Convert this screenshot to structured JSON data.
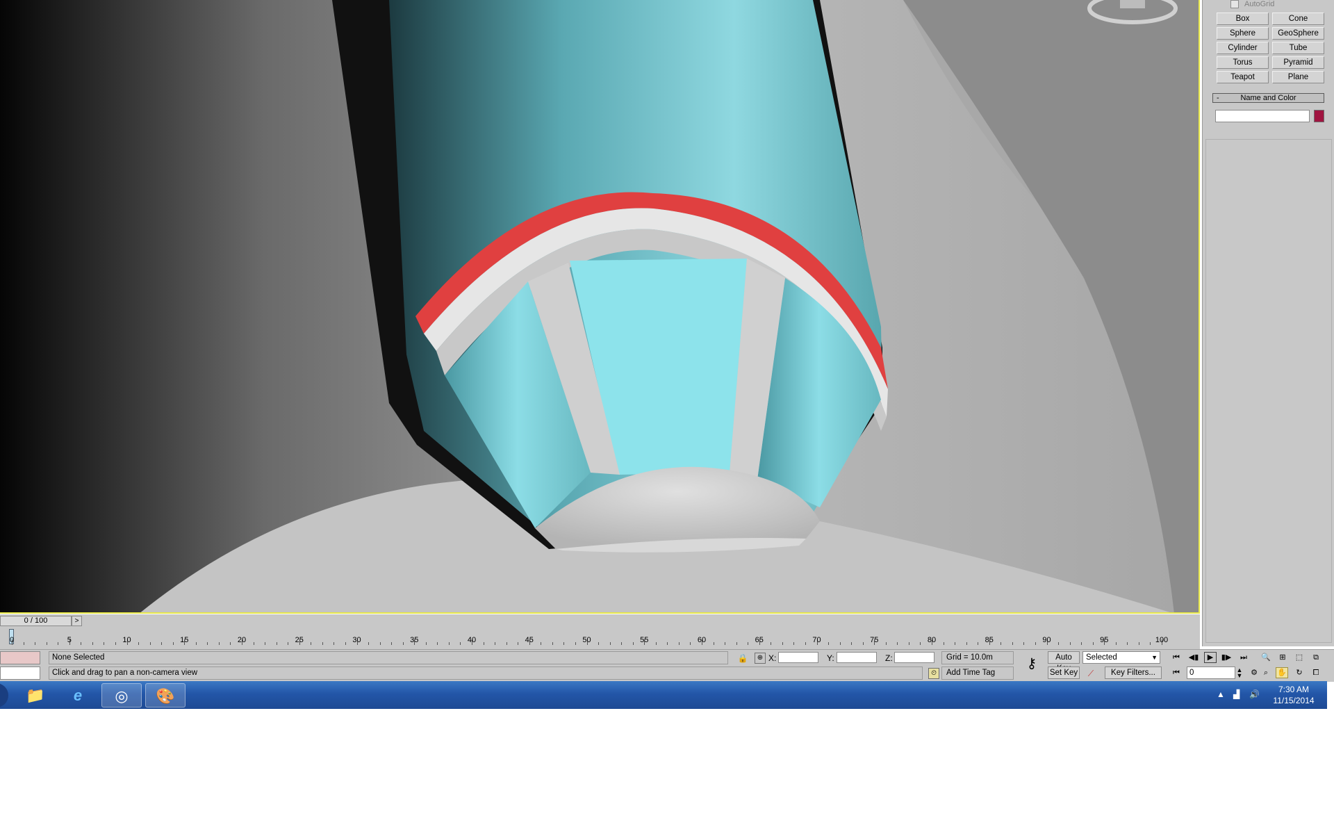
{
  "command_panel": {
    "autogrid_label": "AutoGrid",
    "buttons": [
      "Box",
      "Cone",
      "Sphere",
      "GeoSphere",
      "Cylinder",
      "Tube",
      "Torus",
      "Pyramid",
      "Teapot",
      "Plane"
    ],
    "name_and_color": {
      "rollout_toggle": "-",
      "title": "Name and Color",
      "name_value": "",
      "object_color": "#a01440"
    }
  },
  "time_slider": {
    "position_label": "0 / 100",
    "next_arrow": ">"
  },
  "ruler": {
    "labels": [
      "0",
      "5",
      "10",
      "15",
      "20",
      "25",
      "30",
      "35",
      "40",
      "45",
      "50",
      "55",
      "60",
      "65",
      "70",
      "75",
      "80",
      "85",
      "90",
      "95",
      "100"
    ]
  },
  "status_bar": {
    "selection_status": "None Selected",
    "prompt": "Click and drag to pan a non-camera view",
    "x_label": "X:",
    "y_label": "Y:",
    "z_label": "Z:",
    "x_value": "",
    "y_value": "",
    "z_value": "",
    "grid": "Grid = 10.0m",
    "add_time_tag": "Add Time Tag",
    "auto_key": "Auto Key",
    "set_key": "Set Key",
    "key_filters": "Key Filters...",
    "selection_set": "Selected",
    "current_frame": "0"
  },
  "taskbar": {
    "time": "7:30 AM",
    "date": "11/15/2014"
  },
  "colors": {
    "cyan_body": "#8fd8e0",
    "red_ring": "#e04040",
    "viewport_border": "#e8e84a"
  }
}
